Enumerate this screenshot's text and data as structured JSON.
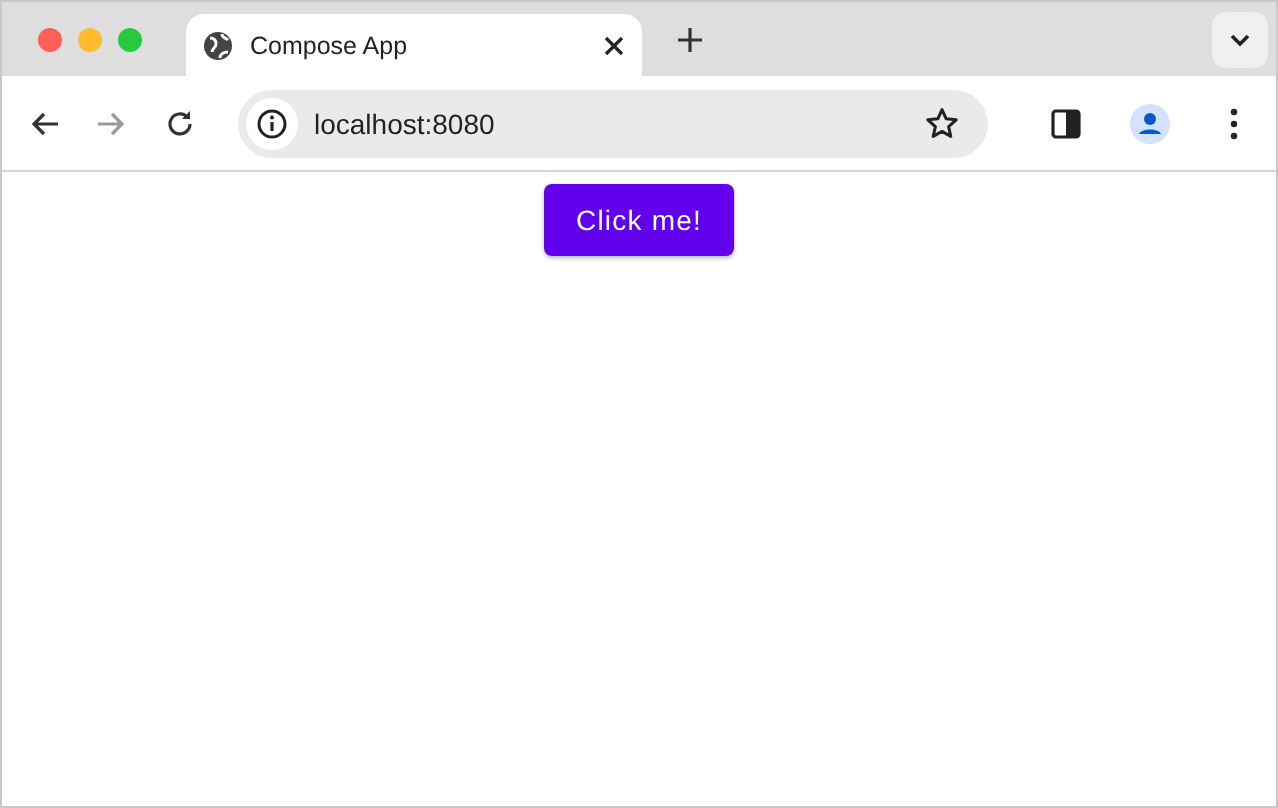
{
  "tabs": [
    {
      "title": "Compose App",
      "selected": true
    }
  ],
  "toolbar": {
    "nav": [
      {
        "kind": "back",
        "disabled": false
      },
      {
        "kind": "forward",
        "disabled": true
      },
      {
        "kind": "reload",
        "disabled": false
      }
    ],
    "address": "localhost:8080"
  },
  "page": {
    "button": "Click me!"
  }
}
